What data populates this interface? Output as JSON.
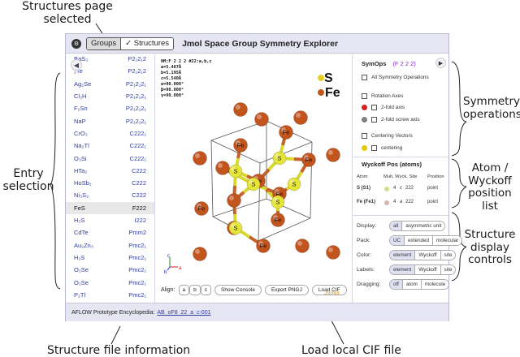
{
  "callouts": {
    "top_line1": "Structures page",
    "top_line2": "selected",
    "entry_line1": "Entry",
    "entry_line2": "selection",
    "symops_line1": "Symmetry",
    "symops_line2": "operations",
    "atom_line1": "Atom /",
    "atom_line2": "Wyckoff",
    "atom_line3": "position list",
    "display_line1": "Structure",
    "display_line2": "display",
    "display_line3": "controls",
    "file_info": "Structure file information",
    "load_cif": "Load local CIF file"
  },
  "app": {
    "title": "Jmol Space Group Symmetry Explorer",
    "tab_groups": "Groups",
    "tab_structures": "✓ Structures",
    "logo": "⚙"
  },
  "entries": [
    {
      "name": "BaS₃",
      "group": "P2₁2₁2"
    },
    {
      "name": "₂Te",
      "group": "P2₁2₁2"
    },
    {
      "name": "Ag₂Se",
      "group": "P2₁2₁2₁"
    },
    {
      "name": "Cl₂H",
      "group": "P2₁2₁2₁"
    },
    {
      "name": "F₂Sn",
      "group": "P2₁2₁2₁"
    },
    {
      "name": "NaP",
      "group": "P2₁2₁2₁"
    },
    {
      "name": "CrO₃",
      "group": "C222₁"
    },
    {
      "name": "Na₂Tl",
      "group": "C222₁"
    },
    {
      "name": "O₃Si",
      "group": "C222₁"
    },
    {
      "name": "HTa₂",
      "group": "C222"
    },
    {
      "name": "HoSb₂",
      "group": "C222"
    },
    {
      "name": "Ni₃S₂",
      "group": "C222"
    },
    {
      "name": "FeS",
      "group": "F222"
    },
    {
      "name": "H₃S",
      "group": "I222"
    },
    {
      "name": "CdTe",
      "group": "Pmm2"
    },
    {
      "name": "Au₂Zn₃",
      "group": "Pmc2₁"
    },
    {
      "name": "H₂S",
      "group": "Pmc2₁"
    },
    {
      "name": "O₂Se",
      "group": "Pmc2₁"
    },
    {
      "name": "O₂Se",
      "group": "Pmc2₁"
    },
    {
      "name": "P₂Tl",
      "group": "Pmc2₁"
    }
  ],
  "selected_entry_index": 12,
  "viewer": {
    "lattice_lines": [
      "HM:F 2 2 2 #22:a,b,c",
      "a=5.487Å",
      "b=5.195Å",
      "c=5.540Å",
      "α=90.000°",
      "β=90.000°",
      "γ=90.000°"
    ],
    "legend_s": "S",
    "legend_fe": "Fe",
    "atom_fe": "Fe",
    "atom_s": "S",
    "axis_a": "a",
    "axis_b": "b",
    "axis_c": "c",
    "align_label": "Align:",
    "align_a": "a",
    "align_b": "b",
    "align_c": "c",
    "show_console": "Show Console",
    "export_png": "Export PNGJ",
    "load_cif": "Load CIF",
    "jsmol": "JSmol",
    "colors": {
      "fe": "#c2541e",
      "s": "#e4e43a",
      "bond": "#b0b070"
    }
  },
  "symops": {
    "header": "SymOps",
    "group": "(F 2 2 2)",
    "all_ops": "All Symmetry Operations",
    "rotation_axes": "Rotation Axes",
    "two_fold": "2-fold axis",
    "two_fold_screw": "2-fold screw axis",
    "centering_vectors": "Centering Vectors",
    "centering": "centering",
    "colors": {
      "two_fold": "#d42020",
      "screw": "#808080",
      "centering": "#e8c800"
    }
  },
  "wyckoff": {
    "header": "Wyckoff Pos (atoms)",
    "col_atom": "Atom",
    "col_mult": "Mult, Wyck, Site",
    "col_pos": "Position",
    "rows": [
      {
        "atom": "S (S1)",
        "mult": "4",
        "wyck": "c",
        "site": "222",
        "pos": "point",
        "color": "#d8dc8a"
      },
      {
        "atom": "Fe (Fe1)",
        "mult": "4",
        "wyck": "a",
        "site": "222",
        "pos": "point",
        "color": "#d8b4a8"
      }
    ]
  },
  "controls": {
    "display": {
      "label": "Display:",
      "options": [
        "all",
        "asymmetric unit"
      ],
      "selected": 0
    },
    "pack": {
      "label": "Pack:",
      "options": [
        "UC",
        "extended",
        "molecular"
      ],
      "selected": 0
    },
    "color": {
      "label": "Color:",
      "options": [
        "element",
        "Wyckoff",
        "site"
      ],
      "selected": 0
    },
    "labels": {
      "label": "Labels:",
      "options": [
        "element",
        "Wyckoff",
        "site"
      ],
      "selected": 0
    },
    "dragging": {
      "label": "Dragging:",
      "options": [
        "off",
        "atom",
        "molecule"
      ],
      "selected": 0
    }
  },
  "footer": {
    "label": "AFLOW Prototype Encyclopedia:",
    "link": "AB_oF8_22_a_c-001"
  }
}
